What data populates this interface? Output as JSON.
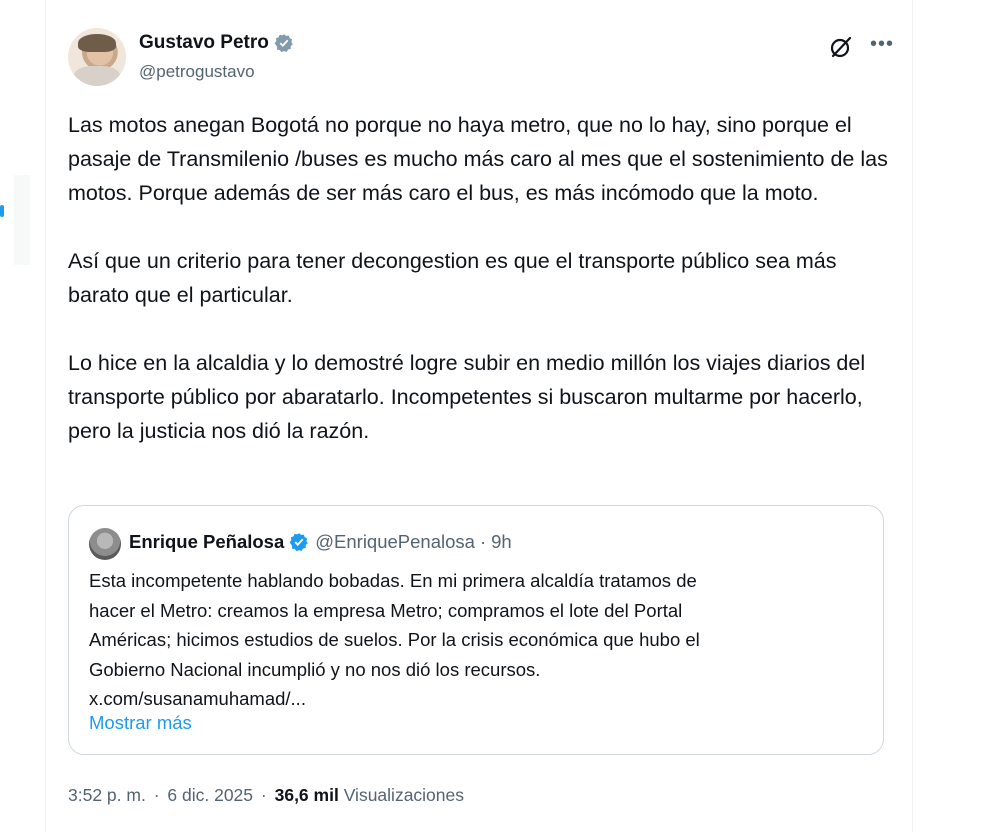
{
  "tweet": {
    "author_name": "Gustavo Petro",
    "author_handle": "@petrogustavo",
    "paragraphs": [
      "Las motos anegan Bogotá no porque no haya metro, que no lo hay, sino porque el pasaje de Transmilenio /buses es mucho más caro al mes que el sostenimiento de las motos. Porque además de ser más caro el bus, es más incómodo que la moto.",
      "Así que un criterio para tener decongestion es que el transporte público sea más barato que el particular.",
      "Lo hice en la alcaldia y lo demostré logre subir en medio millón los viajes diarios del transporte público por abaratarlo. Incompetentes si buscaron multarme por hacerlo, pero la justicia nos dió la razón."
    ],
    "time": "3:52 p. m.",
    "date": "6 dic. 2025",
    "views_count": "36,6 mil",
    "views_label": "Visualizaciones"
  },
  "quote": {
    "author_name": "Enrique Peñalosa",
    "author_handle": "@EnriquePenalosa",
    "separator": "·",
    "time": "9h",
    "text": "Esta incompetente hablando bobadas. En mi primera alcaldía tratamos de\nhacer el Metro: creamos la empresa Metro; compramos el lote del Portal\nAméricas; hicimos estudios de suelos. Por la crisis económica que hubo el\nGobierno Nacional incumplió y no nos dió los recursos.\nx.com/susanamuhamad/...",
    "show_more": "Mostrar más"
  },
  "icons": {
    "verified": "verified-badge-icon",
    "grok": "grok-icon",
    "more": "more-options-icon"
  },
  "colors": {
    "accent": "#1d9bf0",
    "text": "#0f1419",
    "secondary": "#536471",
    "border": "#cfd9de"
  }
}
